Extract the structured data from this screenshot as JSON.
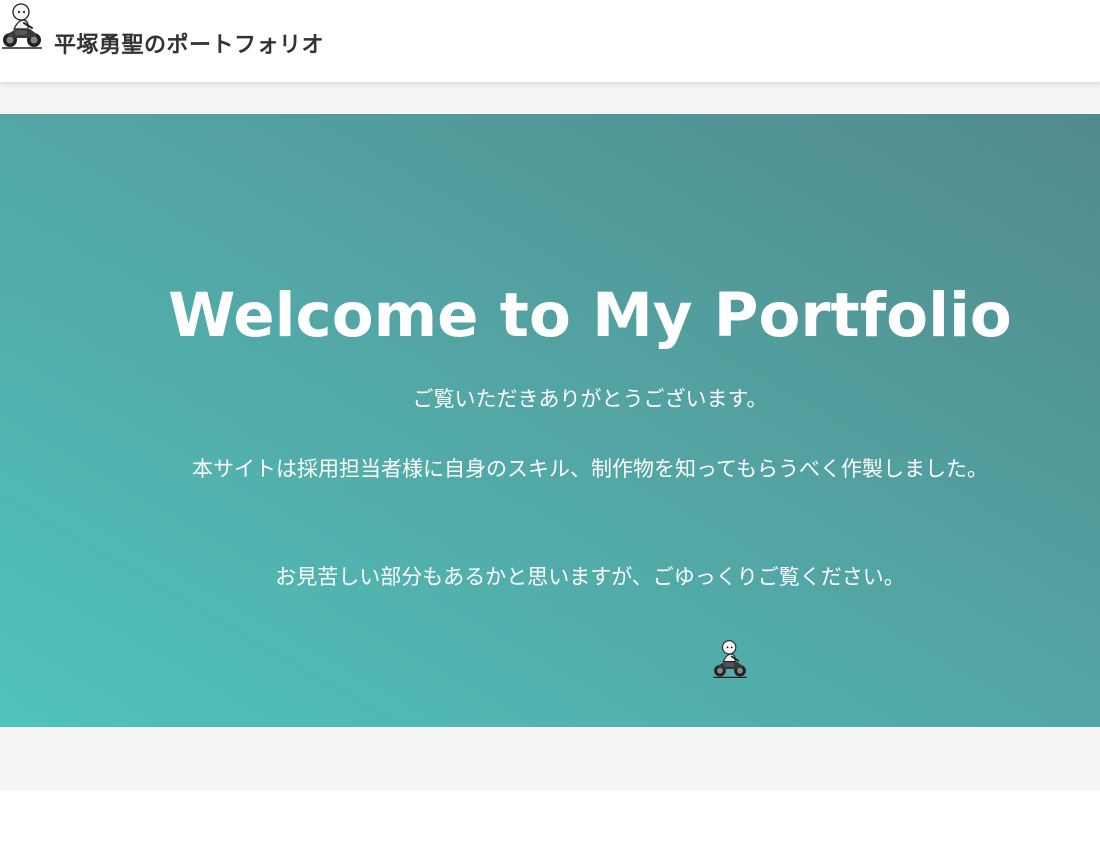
{
  "header": {
    "site_title": "平塚勇聖のポートフォリオ",
    "logo_icon": "rider-on-motorcycle-icon"
  },
  "hero": {
    "title": "Welcome to My Portfolio",
    "paragraphs": [
      "ご覧いただきありがとうございます。",
      "本サイトは採用担当者様に自身のスキル、制作物を知ってもらうべく作製しました。",
      "お見苦しい部分もあるかと思いますが、ごゆっくりご覧ください。"
    ],
    "illustration_icon": "rider-on-motorcycle-icon",
    "gradient_colors": [
      "#4fc3bb",
      "#518a8c"
    ]
  }
}
